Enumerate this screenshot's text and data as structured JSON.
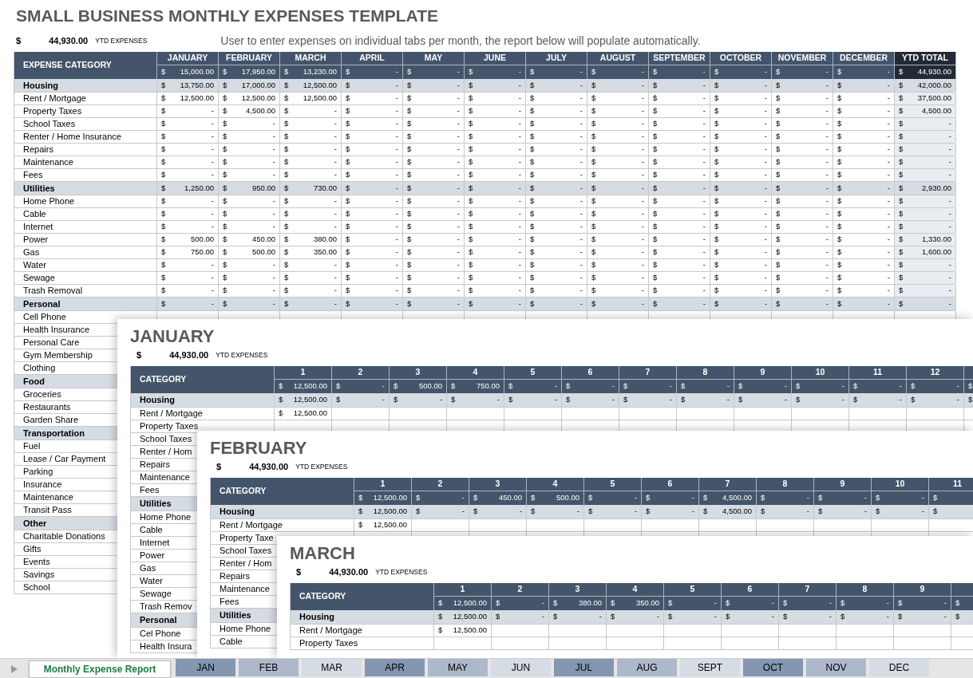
{
  "report": {
    "title": "SMALL BUSINESS MONTHLY EXPENSES TEMPLATE",
    "ytd": {
      "currency": "$",
      "amount": "44,930.00",
      "label": "YTD EXPENSES"
    },
    "note": "User to enter expenses on individual tabs per month, the report below will populate automatically.",
    "table": {
      "category_header": "EXPENSE CATEGORY",
      "months": [
        "JANUARY",
        "FEBRUARY",
        "MARCH",
        "APRIL",
        "MAY",
        "JUNE",
        "JULY",
        "AUGUST",
        "SEPTEMBER",
        "OCTOBER",
        "NOVEMBER",
        "DECEMBER"
      ],
      "total_header": "YTD TOTAL",
      "totals": [
        [
          "$",
          "15,000.00"
        ],
        [
          "$",
          "17,950.00"
        ],
        [
          "$",
          "13,230.00"
        ],
        [
          "$",
          "-"
        ],
        [
          "$",
          "-"
        ],
        [
          "$",
          "-"
        ],
        [
          "$",
          "-"
        ],
        [
          "$",
          "-"
        ],
        [
          "$",
          "-"
        ],
        [
          "$",
          "-"
        ],
        [
          "$",
          "-"
        ],
        [
          "$",
          "-"
        ],
        [
          "$",
          "44,930.00"
        ]
      ],
      "rows": [
        {
          "kind": "section",
          "label": "Housing",
          "cells": [
            [
              "$",
              "13,750.00"
            ],
            [
              "$",
              "17,000.00"
            ],
            [
              "$",
              "12,500.00"
            ],
            [
              "$",
              "-"
            ],
            [
              "$",
              "-"
            ],
            [
              "$",
              "-"
            ],
            [
              "$",
              "-"
            ],
            [
              "$",
              "-"
            ],
            [
              "$",
              "-"
            ],
            [
              "$",
              "-"
            ],
            [
              "$",
              "-"
            ],
            [
              "$",
              "-"
            ],
            [
              "$",
              "42,000.00"
            ]
          ]
        },
        {
          "kind": "item",
          "label": "Rent / Mortgage",
          "cells": [
            [
              "$",
              "12,500.00"
            ],
            [
              "$",
              "12,500.00"
            ],
            [
              "$",
              "12,500.00"
            ],
            [
              "$",
              "-"
            ],
            [
              "$",
              "-"
            ],
            [
              "$",
              "-"
            ],
            [
              "$",
              "-"
            ],
            [
              "$",
              "-"
            ],
            [
              "$",
              "-"
            ],
            [
              "$",
              "-"
            ],
            [
              "$",
              "-"
            ],
            [
              "$",
              "-"
            ],
            [
              "$",
              "37,500.00"
            ]
          ]
        },
        {
          "kind": "item",
          "label": "Property Taxes",
          "cells": [
            [
              "$",
              "-"
            ],
            [
              "$",
              "4,500.00"
            ],
            [
              "$",
              "-"
            ],
            [
              "$",
              "-"
            ],
            [
              "$",
              "-"
            ],
            [
              "$",
              "-"
            ],
            [
              "$",
              "-"
            ],
            [
              "$",
              "-"
            ],
            [
              "$",
              "-"
            ],
            [
              "$",
              "-"
            ],
            [
              "$",
              "-"
            ],
            [
              "$",
              "-"
            ],
            [
              "$",
              "4,500.00"
            ]
          ]
        },
        {
          "kind": "item",
          "label": "School Taxes",
          "cells": [
            [
              "$",
              "-"
            ],
            [
              "$",
              "-"
            ],
            [
              "$",
              "-"
            ],
            [
              "$",
              "-"
            ],
            [
              "$",
              "-"
            ],
            [
              "$",
              "-"
            ],
            [
              "$",
              "-"
            ],
            [
              "$",
              "-"
            ],
            [
              "$",
              "-"
            ],
            [
              "$",
              "-"
            ],
            [
              "$",
              "-"
            ],
            [
              "$",
              "-"
            ],
            [
              "$",
              "-"
            ]
          ]
        },
        {
          "kind": "item",
          "label": "Renter / Home Insurance",
          "cells": [
            [
              "$",
              "-"
            ],
            [
              "$",
              "-"
            ],
            [
              "$",
              "-"
            ],
            [
              "$",
              "-"
            ],
            [
              "$",
              "-"
            ],
            [
              "$",
              "-"
            ],
            [
              "$",
              "-"
            ],
            [
              "$",
              "-"
            ],
            [
              "$",
              "-"
            ],
            [
              "$",
              "-"
            ],
            [
              "$",
              "-"
            ],
            [
              "$",
              "-"
            ],
            [
              "$",
              "-"
            ]
          ]
        },
        {
          "kind": "item",
          "label": "Repairs",
          "cells": [
            [
              "$",
              "-"
            ],
            [
              "$",
              "-"
            ],
            [
              "$",
              "-"
            ],
            [
              "$",
              "-"
            ],
            [
              "$",
              "-"
            ],
            [
              "$",
              "-"
            ],
            [
              "$",
              "-"
            ],
            [
              "$",
              "-"
            ],
            [
              "$",
              "-"
            ],
            [
              "$",
              "-"
            ],
            [
              "$",
              "-"
            ],
            [
              "$",
              "-"
            ],
            [
              "$",
              "-"
            ]
          ]
        },
        {
          "kind": "item",
          "label": "Maintenance",
          "cells": [
            [
              "$",
              "-"
            ],
            [
              "$",
              "-"
            ],
            [
              "$",
              "-"
            ],
            [
              "$",
              "-"
            ],
            [
              "$",
              "-"
            ],
            [
              "$",
              "-"
            ],
            [
              "$",
              "-"
            ],
            [
              "$",
              "-"
            ],
            [
              "$",
              "-"
            ],
            [
              "$",
              "-"
            ],
            [
              "$",
              "-"
            ],
            [
              "$",
              "-"
            ],
            [
              "$",
              "-"
            ]
          ]
        },
        {
          "kind": "item",
          "label": "Fees",
          "cells": [
            [
              "$",
              "-"
            ],
            [
              "$",
              "-"
            ],
            [
              "$",
              "-"
            ],
            [
              "$",
              "-"
            ],
            [
              "$",
              "-"
            ],
            [
              "$",
              "-"
            ],
            [
              "$",
              "-"
            ],
            [
              "$",
              "-"
            ],
            [
              "$",
              "-"
            ],
            [
              "$",
              "-"
            ],
            [
              "$",
              "-"
            ],
            [
              "$",
              "-"
            ],
            [
              "$",
              "-"
            ]
          ]
        },
        {
          "kind": "section",
          "label": "Utilities",
          "cells": [
            [
              "$",
              "1,250.00"
            ],
            [
              "$",
              "950.00"
            ],
            [
              "$",
              "730.00"
            ],
            [
              "$",
              "-"
            ],
            [
              "$",
              "-"
            ],
            [
              "$",
              "-"
            ],
            [
              "$",
              "-"
            ],
            [
              "$",
              "-"
            ],
            [
              "$",
              "-"
            ],
            [
              "$",
              "-"
            ],
            [
              "$",
              "-"
            ],
            [
              "$",
              "-"
            ],
            [
              "$",
              "2,930.00"
            ]
          ]
        },
        {
          "kind": "item",
          "label": "Home Phone",
          "cells": [
            [
              "$",
              "-"
            ],
            [
              "$",
              "-"
            ],
            [
              "$",
              "-"
            ],
            [
              "$",
              "-"
            ],
            [
              "$",
              "-"
            ],
            [
              "$",
              "-"
            ],
            [
              "$",
              "-"
            ],
            [
              "$",
              "-"
            ],
            [
              "$",
              "-"
            ],
            [
              "$",
              "-"
            ],
            [
              "$",
              "-"
            ],
            [
              "$",
              "-"
            ],
            [
              "$",
              "-"
            ]
          ]
        },
        {
          "kind": "item",
          "label": "Cable",
          "cells": [
            [
              "$",
              "-"
            ],
            [
              "$",
              "-"
            ],
            [
              "$",
              "-"
            ],
            [
              "$",
              "-"
            ],
            [
              "$",
              "-"
            ],
            [
              "$",
              "-"
            ],
            [
              "$",
              "-"
            ],
            [
              "$",
              "-"
            ],
            [
              "$",
              "-"
            ],
            [
              "$",
              "-"
            ],
            [
              "$",
              "-"
            ],
            [
              "$",
              "-"
            ],
            [
              "$",
              "-"
            ]
          ]
        },
        {
          "kind": "item",
          "label": "Internet",
          "cells": [
            [
              "$",
              "-"
            ],
            [
              "$",
              "-"
            ],
            [
              "$",
              "-"
            ],
            [
              "$",
              "-"
            ],
            [
              "$",
              "-"
            ],
            [
              "$",
              "-"
            ],
            [
              "$",
              "-"
            ],
            [
              "$",
              "-"
            ],
            [
              "$",
              "-"
            ],
            [
              "$",
              "-"
            ],
            [
              "$",
              "-"
            ],
            [
              "$",
              "-"
            ],
            [
              "$",
              "-"
            ]
          ]
        },
        {
          "kind": "item",
          "label": "Power",
          "cells": [
            [
              "$",
              "500.00"
            ],
            [
              "$",
              "450.00"
            ],
            [
              "$",
              "380.00"
            ],
            [
              "$",
              "-"
            ],
            [
              "$",
              "-"
            ],
            [
              "$",
              "-"
            ],
            [
              "$",
              "-"
            ],
            [
              "$",
              "-"
            ],
            [
              "$",
              "-"
            ],
            [
              "$",
              "-"
            ],
            [
              "$",
              "-"
            ],
            [
              "$",
              "-"
            ],
            [
              "$",
              "1,330.00"
            ]
          ]
        },
        {
          "kind": "item",
          "label": "Gas",
          "cells": [
            [
              "$",
              "750.00"
            ],
            [
              "$",
              "500.00"
            ],
            [
              "$",
              "350.00"
            ],
            [
              "$",
              "-"
            ],
            [
              "$",
              "-"
            ],
            [
              "$",
              "-"
            ],
            [
              "$",
              "-"
            ],
            [
              "$",
              "-"
            ],
            [
              "$",
              "-"
            ],
            [
              "$",
              "-"
            ],
            [
              "$",
              "-"
            ],
            [
              "$",
              "-"
            ],
            [
              "$",
              "1,600.00"
            ]
          ]
        },
        {
          "kind": "item",
          "label": "Water",
          "cells": [
            [
              "$",
              "-"
            ],
            [
              "$",
              "-"
            ],
            [
              "$",
              "-"
            ],
            [
              "$",
              "-"
            ],
            [
              "$",
              "-"
            ],
            [
              "$",
              "-"
            ],
            [
              "$",
              "-"
            ],
            [
              "$",
              "-"
            ],
            [
              "$",
              "-"
            ],
            [
              "$",
              "-"
            ],
            [
              "$",
              "-"
            ],
            [
              "$",
              "-"
            ],
            [
              "$",
              "-"
            ]
          ]
        },
        {
          "kind": "item",
          "label": "Sewage",
          "cells": [
            [
              "$",
              "-"
            ],
            [
              "$",
              "-"
            ],
            [
              "$",
              "-"
            ],
            [
              "$",
              "-"
            ],
            [
              "$",
              "-"
            ],
            [
              "$",
              "-"
            ],
            [
              "$",
              "-"
            ],
            [
              "$",
              "-"
            ],
            [
              "$",
              "-"
            ],
            [
              "$",
              "-"
            ],
            [
              "$",
              "-"
            ],
            [
              "$",
              "-"
            ],
            [
              "$",
              "-"
            ]
          ]
        },
        {
          "kind": "item",
          "label": "Trash Removal",
          "cells": [
            [
              "$",
              "-"
            ],
            [
              "$",
              "-"
            ],
            [
              "$",
              "-"
            ],
            [
              "$",
              "-"
            ],
            [
              "$",
              "-"
            ],
            [
              "$",
              "-"
            ],
            [
              "$",
              "-"
            ],
            [
              "$",
              "-"
            ],
            [
              "$",
              "-"
            ],
            [
              "$",
              "-"
            ],
            [
              "$",
              "-"
            ],
            [
              "$",
              "-"
            ],
            [
              "$",
              "-"
            ]
          ]
        },
        {
          "kind": "section",
          "label": "Personal",
          "cells": [
            [
              "$",
              "-"
            ],
            [
              "$",
              "-"
            ],
            [
              "$",
              "-"
            ],
            [
              "$",
              "-"
            ],
            [
              "$",
              "-"
            ],
            [
              "$",
              "-"
            ],
            [
              "$",
              "-"
            ],
            [
              "$",
              "-"
            ],
            [
              "$",
              "-"
            ],
            [
              "$",
              "-"
            ],
            [
              "$",
              "-"
            ],
            [
              "$",
              "-"
            ],
            [
              "$",
              "-"
            ]
          ]
        },
        {
          "kind": "item",
          "label": "Cell Phone"
        },
        {
          "kind": "item",
          "label": "Health Insurance"
        },
        {
          "kind": "item",
          "label": "Personal Care"
        },
        {
          "kind": "item",
          "label": "Gym Membership"
        },
        {
          "kind": "item",
          "label": "Clothing"
        },
        {
          "kind": "section",
          "label": "Food"
        },
        {
          "kind": "item",
          "label": "Groceries"
        },
        {
          "kind": "item",
          "label": "Restaurants"
        },
        {
          "kind": "item",
          "label": "Garden Share"
        },
        {
          "kind": "section",
          "label": "Transportation"
        },
        {
          "kind": "item",
          "label": "Fuel"
        },
        {
          "kind": "item",
          "label": "Lease / Car Payment"
        },
        {
          "kind": "item",
          "label": "Parking"
        },
        {
          "kind": "item",
          "label": "Insurance"
        },
        {
          "kind": "item",
          "label": "Maintenance"
        },
        {
          "kind": "item",
          "label": "Transit Pass"
        },
        {
          "kind": "section",
          "label": "Other"
        },
        {
          "kind": "item",
          "label": "Charitable Donations"
        },
        {
          "kind": "item",
          "label": "Gifts"
        },
        {
          "kind": "item",
          "label": "Events"
        },
        {
          "kind": "item",
          "label": "Savings"
        },
        {
          "kind": "item",
          "label": "School"
        }
      ]
    }
  },
  "sheets": [
    {
      "title": "JANUARY",
      "ytd": {
        "currency": "$",
        "amount": "44,930.00",
        "label": "YTD EXPENSES"
      },
      "category_header": "CATEGORY",
      "days": [
        "1",
        "2",
        "3",
        "4",
        "5",
        "6",
        "7",
        "8",
        "9",
        "10",
        "11",
        "12"
      ],
      "totals": [
        [
          "$",
          "12,500.00"
        ],
        [
          "$",
          "-"
        ],
        [
          "$",
          "500.00"
        ],
        [
          "$",
          "750.00"
        ],
        [
          "$",
          "-"
        ],
        [
          "$",
          "-"
        ],
        [
          "$",
          "-"
        ],
        [
          "$",
          "-"
        ],
        [
          "$",
          "-"
        ],
        [
          "$",
          "-"
        ],
        [
          "$",
          "-"
        ],
        [
          "$",
          "-"
        ],
        [
          "$"
        ]
      ],
      "rows": [
        {
          "kind": "section",
          "label": "Housing",
          "cells": [
            [
              "$",
              "12,500.00"
            ],
            [
              "$",
              "-"
            ],
            [
              "$",
              "-"
            ],
            [
              "$",
              "-"
            ],
            [
              "$",
              "-"
            ],
            [
              "$",
              "-"
            ],
            [
              "$",
              "-"
            ],
            [
              "$",
              "-"
            ],
            [
              "$",
              "-"
            ],
            [
              "$",
              "-"
            ],
            [
              "$",
              "-"
            ],
            [
              "$",
              "-"
            ],
            [
              "$"
            ]
          ]
        },
        {
          "kind": "item",
          "label": "Rent / Mortgage",
          "cells": [
            [
              "$",
              "12,500.00"
            ]
          ]
        },
        {
          "kind": "item",
          "label": "Property Taxes"
        },
        {
          "kind": "item",
          "label": "School Taxes"
        },
        {
          "kind": "item",
          "label": "Renter / Hom"
        },
        {
          "kind": "item",
          "label": "Repairs"
        },
        {
          "kind": "item",
          "label": "Maintenance"
        },
        {
          "kind": "item",
          "label": "Fees"
        },
        {
          "kind": "section",
          "label": "Utilities"
        },
        {
          "kind": "item",
          "label": "Home Phone"
        },
        {
          "kind": "item",
          "label": "Cable"
        },
        {
          "kind": "item",
          "label": "Internet"
        },
        {
          "kind": "item",
          "label": "Power"
        },
        {
          "kind": "item",
          "label": "Gas"
        },
        {
          "kind": "item",
          "label": "Water"
        },
        {
          "kind": "item",
          "label": "Sewage"
        },
        {
          "kind": "item",
          "label": "Trash Remov"
        },
        {
          "kind": "section",
          "label": "Personal"
        },
        {
          "kind": "item",
          "label": "Cel Phone"
        },
        {
          "kind": "item",
          "label": "Health Insura"
        }
      ]
    },
    {
      "title": "FEBRUARY",
      "ytd": {
        "currency": "$",
        "amount": "44,930.00",
        "label": "YTD EXPENSES"
      },
      "category_header": "CATEGORY",
      "days": [
        "1",
        "2",
        "3",
        "4",
        "5",
        "6",
        "7",
        "8",
        "9",
        "10",
        "11"
      ],
      "totals": [
        [
          "$",
          "12,500.00"
        ],
        [
          "$",
          "-"
        ],
        [
          "$",
          "450.00"
        ],
        [
          "$",
          "500.00"
        ],
        [
          "$",
          "-"
        ],
        [
          "$",
          "-"
        ],
        [
          "$",
          "4,500.00"
        ],
        [
          "$",
          "-"
        ],
        [
          "$",
          "-"
        ],
        [
          "$",
          "-"
        ],
        [
          "$"
        ]
      ],
      "rows": [
        {
          "kind": "section",
          "label": "Housing",
          "cells": [
            [
              "$",
              "12,500.00"
            ],
            [
              "$",
              "-"
            ],
            [
              "$",
              "-"
            ],
            [
              "$",
              "-"
            ],
            [
              "$",
              "-"
            ],
            [
              "$",
              "-"
            ],
            [
              "$",
              "4,500.00"
            ],
            [
              "$",
              "-"
            ],
            [
              "$",
              "-"
            ],
            [
              "$",
              "-"
            ],
            [
              "$"
            ]
          ]
        },
        {
          "kind": "item",
          "label": "Rent / Mortgage",
          "cells": [
            [
              "$",
              "12,500.00"
            ]
          ]
        },
        {
          "kind": "item",
          "label": "Property Taxe"
        },
        {
          "kind": "item",
          "label": "School Taxes"
        },
        {
          "kind": "item",
          "label": "Renter / Hom"
        },
        {
          "kind": "item",
          "label": "Repairs"
        },
        {
          "kind": "item",
          "label": "Maintenance"
        },
        {
          "kind": "item",
          "label": "Fees"
        },
        {
          "kind": "section",
          "label": "Utilities"
        },
        {
          "kind": "item",
          "label": "Home Phone"
        },
        {
          "kind": "item",
          "label": "Cable"
        }
      ]
    },
    {
      "title": "MARCH",
      "ytd": {
        "currency": "$",
        "amount": "44,930.00",
        "label": "YTD EXPENSES"
      },
      "category_header": "CATEGORY",
      "days": [
        "1",
        "2",
        "3",
        "4",
        "5",
        "6",
        "7",
        "8",
        "9"
      ],
      "totals": [
        [
          "$",
          "12,500.00"
        ],
        [
          "$",
          "-"
        ],
        [
          "$",
          "380.00"
        ],
        [
          "$",
          "350.00"
        ],
        [
          "$",
          "-"
        ],
        [
          "$",
          "-"
        ],
        [
          "$",
          "-"
        ],
        [
          "$",
          "-"
        ],
        [
          "$",
          "-"
        ],
        [
          "$"
        ]
      ],
      "rows": [
        {
          "kind": "section",
          "label": "Housing",
          "cells": [
            [
              "$",
              "12,500.00"
            ],
            [
              "$",
              "-"
            ],
            [
              "$",
              "-"
            ],
            [
              "$",
              "-"
            ],
            [
              "$",
              "-"
            ],
            [
              "$",
              "-"
            ],
            [
              "$",
              "-"
            ],
            [
              "$",
              "-"
            ],
            [
              "$",
              "-"
            ],
            [
              "$"
            ]
          ]
        },
        {
          "kind": "item",
          "label": "Rent / Mortgage",
          "cells": [
            [
              "$",
              "12,500.00"
            ]
          ]
        },
        {
          "kind": "item",
          "label": "Property Taxes"
        }
      ]
    }
  ],
  "tabs": [
    {
      "label": "Monthly Expense Report",
      "selected": true
    },
    {
      "label": "JAN",
      "selected": false,
      "color": "#8496b0"
    },
    {
      "label": "FEB",
      "selected": false,
      "color": "#adb9ca"
    },
    {
      "label": "MAR",
      "selected": false,
      "color": "#d6dce4"
    },
    {
      "label": "APR",
      "selected": false,
      "color": "#8496b0"
    },
    {
      "label": "MAY",
      "selected": false,
      "color": "#adb9ca"
    },
    {
      "label": "JUN",
      "selected": false,
      "color": "#d6dce4"
    },
    {
      "label": "JUL",
      "selected": false,
      "color": "#8496b0"
    },
    {
      "label": "AUG",
      "selected": false,
      "color": "#adb9ca"
    },
    {
      "label": "SEPT",
      "selected": false,
      "color": "#d6dce4"
    },
    {
      "label": "OCT",
      "selected": false,
      "color": "#8496b0"
    },
    {
      "label": "NOV",
      "selected": false,
      "color": "#adb9ca"
    },
    {
      "label": "DEC",
      "selected": false,
      "color": "#d6dce4"
    }
  ]
}
